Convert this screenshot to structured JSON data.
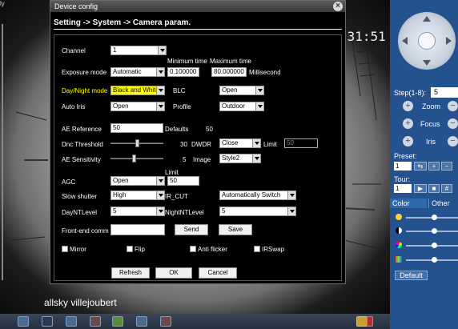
{
  "camera": {
    "clock": ":31:51",
    "caption": "allsky villejoubert"
  },
  "dialog": {
    "title": "Device config",
    "breadcrumb": "Setting -> System -> Camera param.",
    "labels": {
      "channel": "Channel",
      "exposure_mode": "Exposure mode",
      "min_time": "Minimum time",
      "max_time": "Maximum time",
      "millisecond": "Millisecond",
      "day_night_mode": "Day/Night mode",
      "blc": "BLC",
      "auto_iris": "Auto Iris",
      "profile": "Profile",
      "ae_reference": "AE Reference",
      "defaults": "Defaults",
      "defaults_value": "50",
      "dnc_threshold": "Dnc Threshold",
      "dnc_value": "30",
      "dwdr": "DWDR",
      "limit": "Limit",
      "ae_sensitivity": "AE Sensitivity",
      "ae_sens_value": "5",
      "image": "Image",
      "agc": "AGC",
      "limit2": "Limit",
      "slow_shutter": "Slow shutter",
      "ir_cut": "IR_CUT",
      "day_nt_level": "DayNTLevel",
      "night_nt_level": "NightNTLevel",
      "front_end_comm": "Front-end comm"
    },
    "values": {
      "channel": "1",
      "exposure_mode": "Automatic",
      "min_time": "0.100000",
      "max_time": "80.000000",
      "day_night_mode": "Black and White",
      "blc": "Open",
      "auto_iris": "Open",
      "profile": "Outdoor",
      "ae_reference": "50",
      "dwdr": "Close",
      "dwdr_limit": "50",
      "image": "Style2",
      "agc": "Open",
      "agc_limit": "50",
      "slow_shutter": "High",
      "ir_cut": "Automatically Switch",
      "day_nt_level": "5",
      "night_nt_level": "5",
      "front_end_comm": ""
    },
    "sliders": {
      "dnc_threshold_fraction": 0.5,
      "ae_sensitivity_fraction": 0.45
    },
    "buttons": {
      "send": "Send",
      "save": "Save",
      "refresh": "Refresh",
      "ok": "OK",
      "cancel": "Cancel"
    },
    "checkboxes": {
      "mirror": "Mirror",
      "flip": "Flip",
      "anti_flicker": "Anti flicker",
      "irswap": "IRSwap"
    }
  },
  "right_panel": {
    "step_label": "Step(1-8):",
    "step_value": "5",
    "zoom": "Zoom",
    "focus": "Focus",
    "iris": "Iris",
    "preset_label": "Preset:",
    "preset_value": "1",
    "tour_label": "Tour:",
    "tour_value": "1",
    "tabs": [
      "Color",
      "Other"
    ],
    "default_button": "Default"
  }
}
